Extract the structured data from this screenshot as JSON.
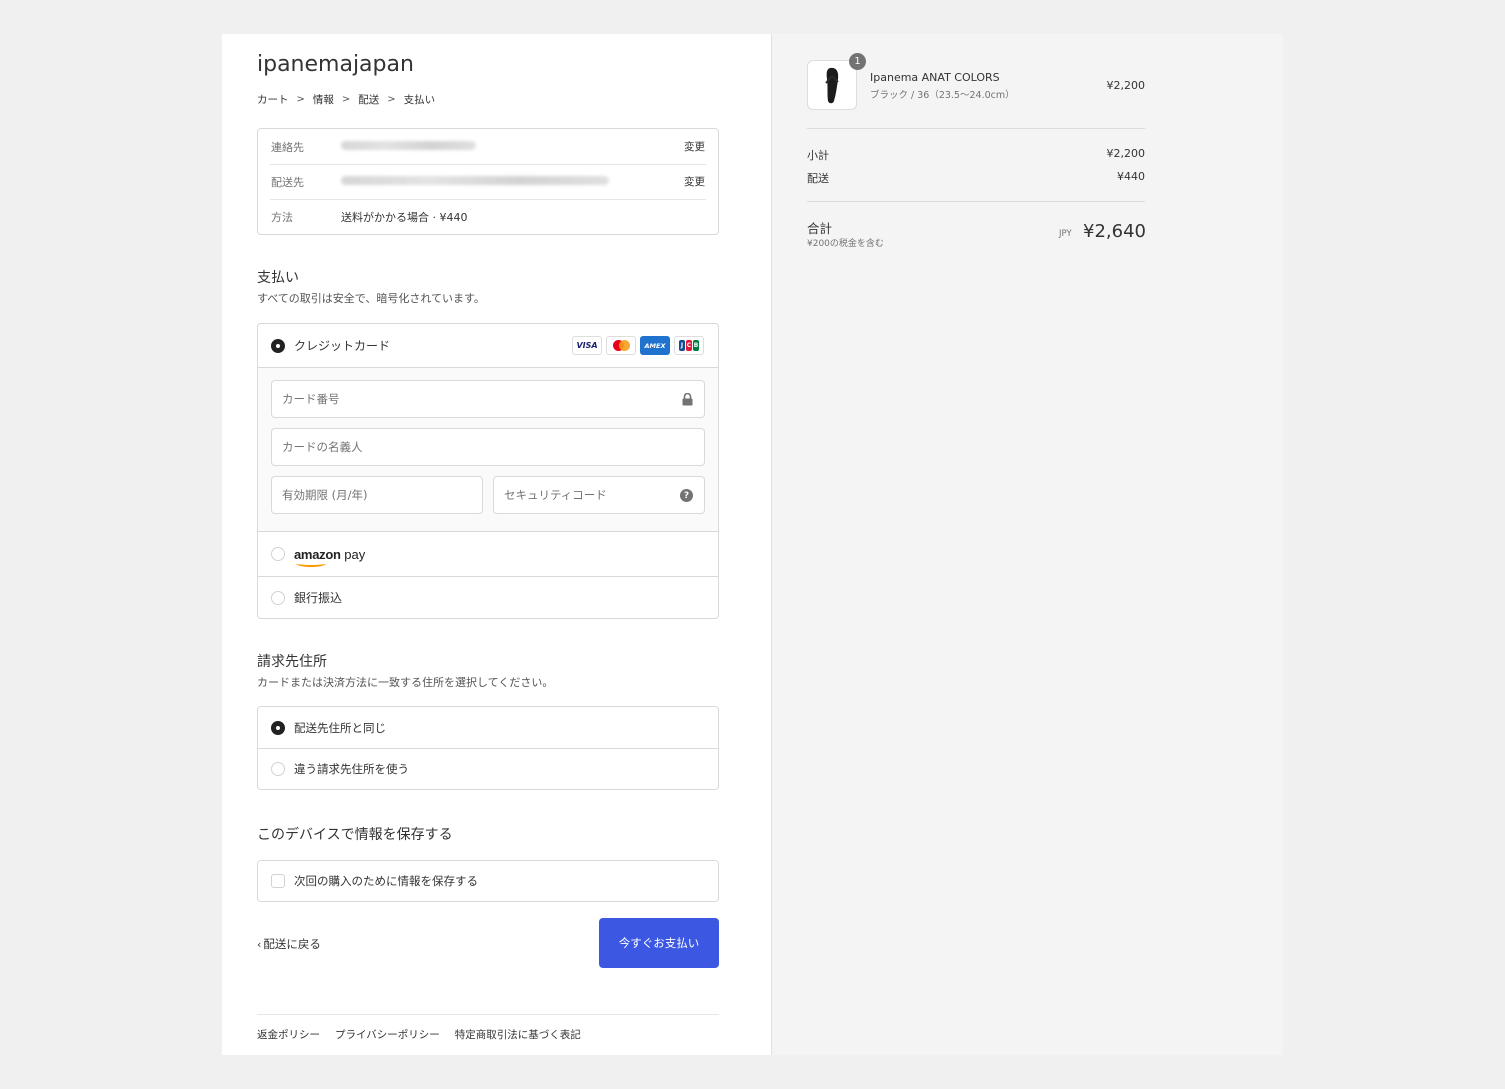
{
  "shop": {
    "name": "ipanemajapan"
  },
  "breadcrumb": [
    "カート",
    "情報",
    "配送",
    "支払い"
  ],
  "review": {
    "rows": [
      {
        "label": "連絡先",
        "link": "変更"
      },
      {
        "label": "配送先",
        "link": "変更"
      },
      {
        "label": "方法",
        "value": "送料がかかる場合 · ¥440"
      }
    ]
  },
  "payment": {
    "title": "支払い",
    "subtitle": "すべての取引は安全で、暗号化されています。",
    "credit_card_label": "クレジットカード",
    "card_brands": [
      "VISA",
      "Mastercard",
      "AMEX",
      "JCB"
    ],
    "card_number_placeholder": "カード番号",
    "card_name_placeholder": "カードの名義人",
    "expiry_placeholder": "有効期限 (月/年)",
    "cvc_placeholder": "セキュリティコード",
    "amazon_pay": {
      "brand": "amazon",
      "suffix": "pay"
    },
    "bank_transfer_label": "銀行振込",
    "selected": "credit_card"
  },
  "billing": {
    "title": "請求先住所",
    "subtitle": "カードまたは決済方法に一致する住所を選択してください。",
    "same_label": "配送先住所と同じ",
    "different_label": "違う請求先住所を使う",
    "selected": "same"
  },
  "save_info": {
    "title": "このデバイスで情報を保存する",
    "checkbox_label": "次回の購入のために情報を保存する",
    "checked": false
  },
  "actions": {
    "back_label": "配送に戻る",
    "pay_label": "今すぐお支払い"
  },
  "footer": {
    "links": [
      "返金ポリシー",
      "プライバシーポリシー",
      "特定商取引法に基づく表記"
    ]
  },
  "summary": {
    "product": {
      "quantity": "1",
      "name": "Ipanema ANAT COLORS",
      "variant": "ブラック / 36（23.5〜24.0cm）",
      "price": "¥2,200"
    },
    "subtotal_label": "小計",
    "subtotal": "¥2,200",
    "shipping_label": "配送",
    "shipping": "¥440",
    "total_label": "合計",
    "tax_note": "¥200の税金を含む",
    "currency": "JPY",
    "total": "¥2,640"
  },
  "colors": {
    "pay_button": "#3c57e2",
    "background": "#f0f0f0",
    "sidebar": "#f4f4f4"
  }
}
